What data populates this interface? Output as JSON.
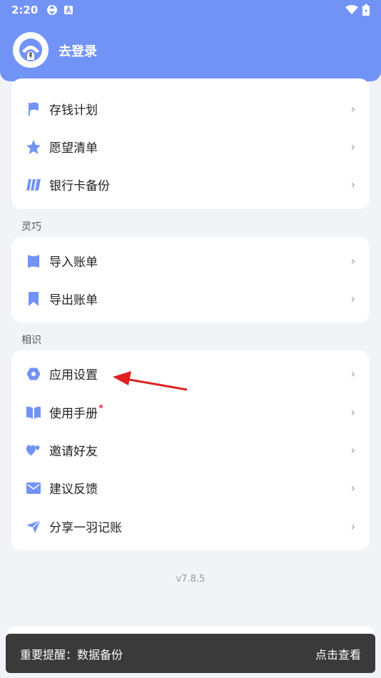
{
  "status": {
    "time": "2:20"
  },
  "header": {
    "login": "去登录"
  },
  "group1": {
    "items": [
      {
        "label": "存钱计划",
        "icon": "flag-icon"
      },
      {
        "label": "愿望清单",
        "icon": "star-icon"
      },
      {
        "label": "银行卡备份",
        "icon": "card-icon"
      }
    ]
  },
  "group2": {
    "title": "灵巧",
    "items": [
      {
        "label": "导入账单",
        "icon": "import-icon"
      },
      {
        "label": "导出账单",
        "icon": "export-icon"
      }
    ]
  },
  "group3": {
    "title": "相识",
    "items": [
      {
        "label": "应用设置",
        "icon": "settings-icon"
      },
      {
        "label": "使用手册",
        "icon": "book-icon"
      },
      {
        "label": "邀请好友",
        "icon": "hearts-icon"
      },
      {
        "label": "建议反馈",
        "icon": "mail-icon"
      },
      {
        "label": "分享一羽记账",
        "icon": "send-icon"
      }
    ]
  },
  "version": "v7.8.5",
  "toast": {
    "message": "重要提醒：数据备份",
    "action": "点击查看"
  },
  "colors": {
    "accent": "#7293f6",
    "red_dot": "#f0546a"
  }
}
